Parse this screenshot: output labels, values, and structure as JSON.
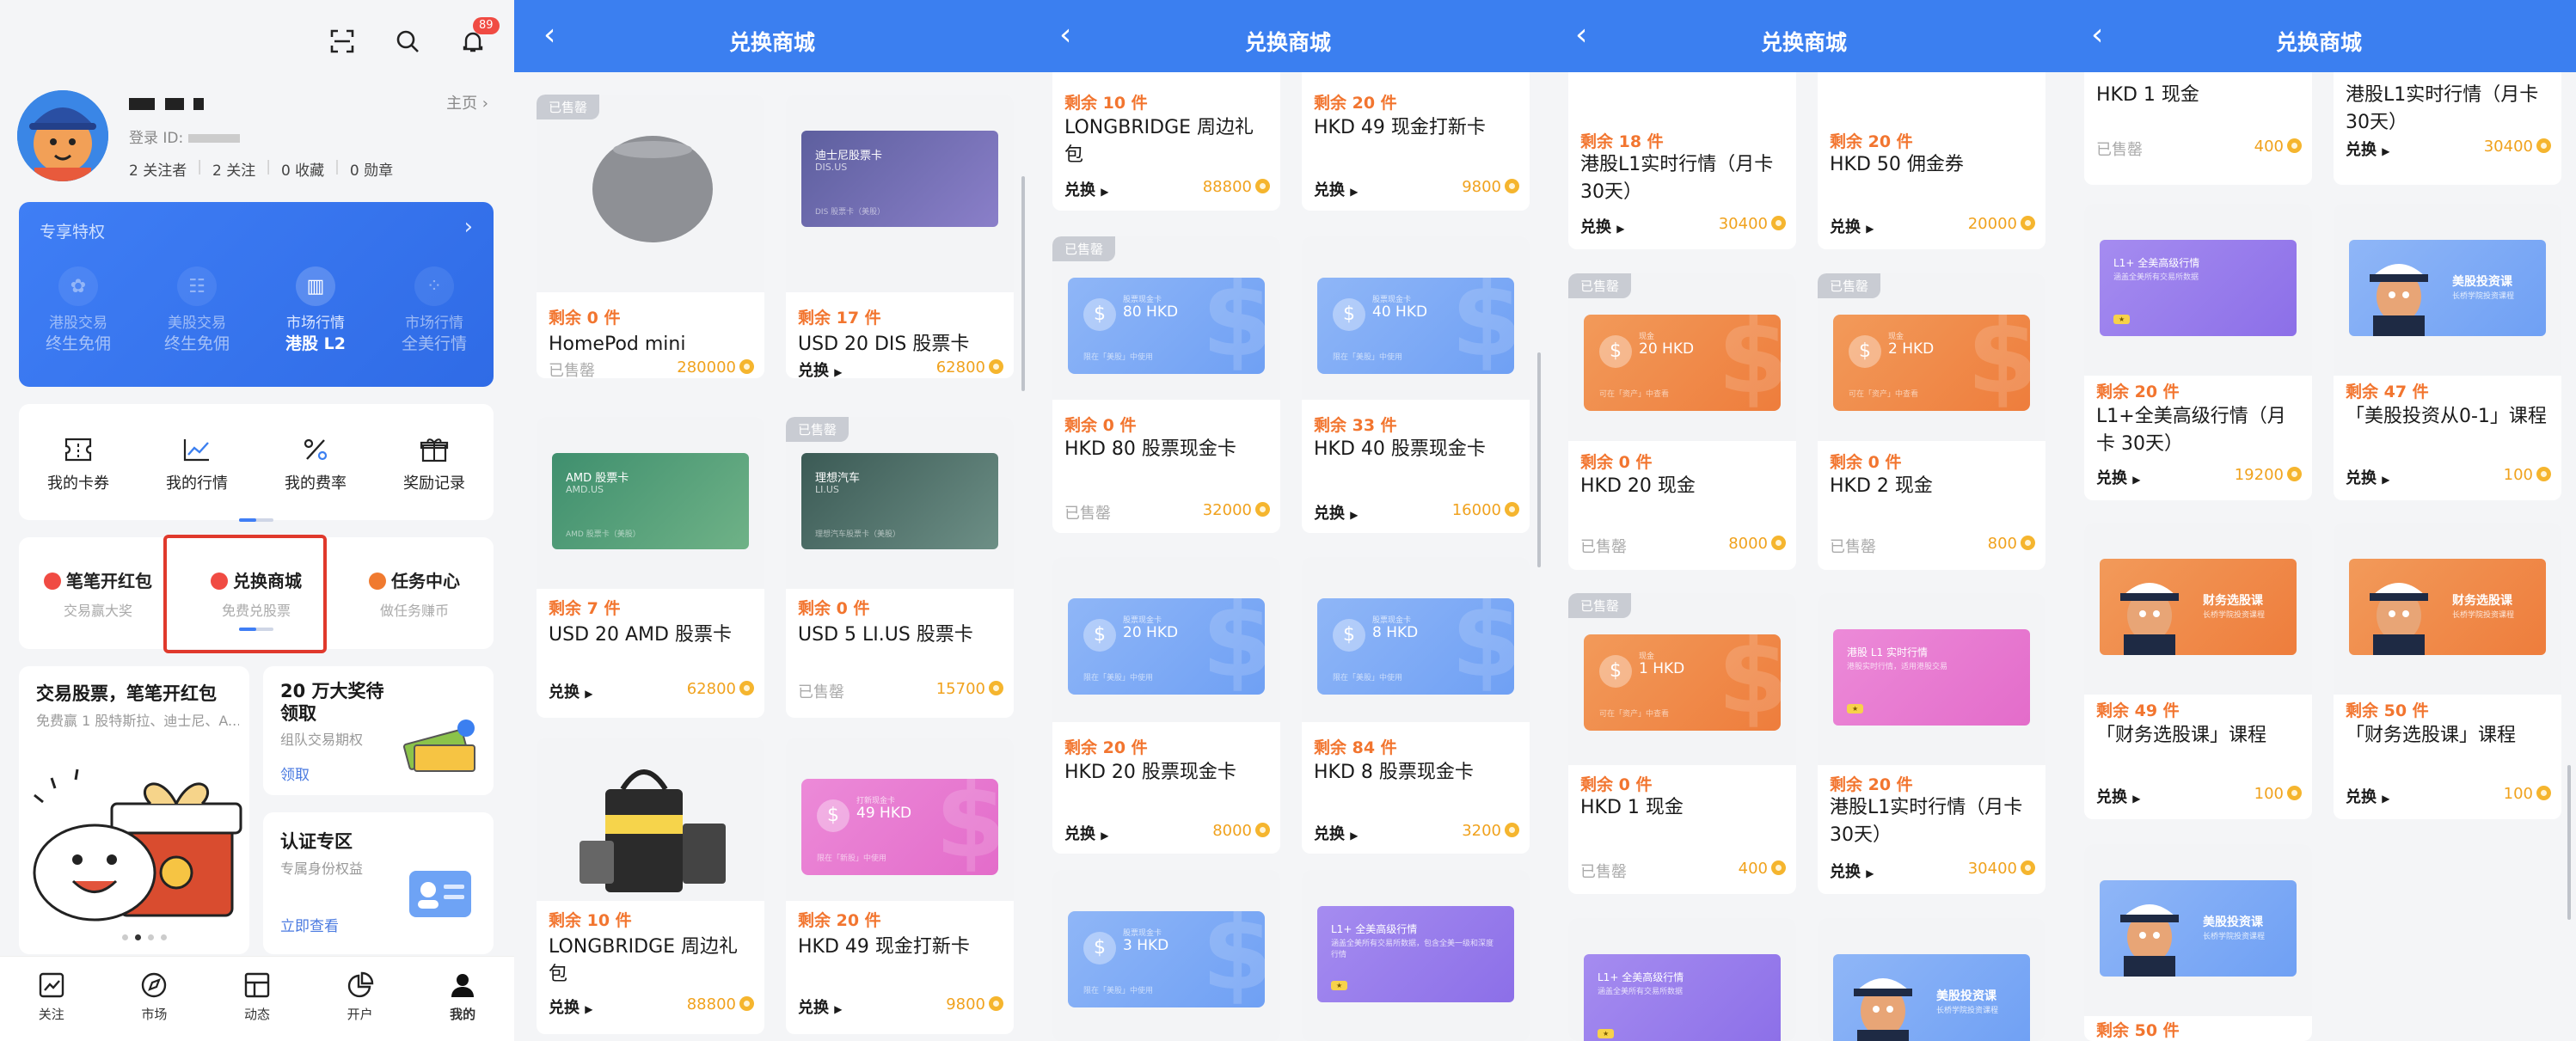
{
  "profile": {
    "badge_count": "89",
    "login_label": "登录 ID:",
    "home_link": "主页 ›",
    "stats": [
      "2 关注者",
      "2 关注",
      "0 收藏",
      "0 勋章"
    ],
    "vip": {
      "title": "专享特权",
      "items": [
        {
          "l1": "港股交易",
          "l2": "终生免佣",
          "on": false,
          "icon": "hongkong-flower-icon"
        },
        {
          "l1": "美股交易",
          "l2": "终生免佣",
          "on": false,
          "icon": "us-flag-icon"
        },
        {
          "l1": "市场行情",
          "l2": "港股 L2",
          "on": true,
          "icon": "bar-chart-icon"
        },
        {
          "l1": "市场行情",
          "l2": "全美行情",
          "on": false,
          "icon": "grid-icon"
        }
      ]
    },
    "quick": [
      "我的卡券",
      "我的行情",
      "我的费率",
      "奖励记录"
    ],
    "triple": [
      {
        "main": "笔笔开红包",
        "sub": "交易赢大奖",
        "color": "#f04b43"
      },
      {
        "main": "兑换商城",
        "sub": "免费兑股票",
        "color": "#f04b43"
      },
      {
        "main": "任务中心",
        "sub": "做任务赚币",
        "color": "#f07a2f"
      }
    ],
    "promo1": {
      "title": "交易股票，笔笔开红包",
      "sub": "免费赢 1 股特斯拉、迪士尼、A..."
    },
    "promo2": {
      "title": "20 万大奖待领取",
      "sub": "组队交易期权",
      "link": "领取"
    },
    "promo3": {
      "title": "认证专区",
      "sub": "专属身份权益",
      "link": "立即查看"
    },
    "tabs": [
      "关注",
      "市场",
      "动态",
      "开户",
      "我的"
    ]
  },
  "shop": {
    "title": "兑换商城",
    "sold_tag": "已售罄",
    "redeem": "兑换",
    "panels": [
      [
        {
          "rem": "剩余 0 件",
          "name": "HomePod mini",
          "act": "已售罄",
          "pts": "280000",
          "sold": true,
          "img": "homepod"
        },
        {
          "rem": "剩余 17 件",
          "name": "USD 20 DIS 股票卡",
          "act": "兑换",
          "pts": "62800",
          "sold": false,
          "img": "dis",
          "card_title": "迪士尼股票卡",
          "card_code": "DIS.US",
          "card_note": "DIS 股票卡（美股）"
        },
        {
          "rem": "剩余 7 件",
          "name": "USD 20 AMD 股票卡",
          "act": "兑换",
          "pts": "62800",
          "sold": false,
          "img": "amd",
          "card_title": "AMD 股票卡",
          "card_code": "AMD.US",
          "card_note": "AMD 股票卡（美股）"
        },
        {
          "rem": "剩余 0 件",
          "name": "USD 5 LI.US 股票卡",
          "act": "已售罄",
          "pts": "15700",
          "sold": true,
          "img": "li",
          "card_title": "理想汽车",
          "card_code": "LI.US",
          "card_note": "理想汽车股票卡（美股）"
        },
        {
          "rem": "剩余 10 件",
          "name": "LONGBRIDGE 周边礼包",
          "act": "兑换",
          "pts": "88800",
          "sold": false,
          "img": "bag"
        },
        {
          "rem": "剩余 20 件",
          "name": "HKD 49 现金打新卡",
          "act": "兑换",
          "pts": "9800",
          "sold": false,
          "img": "voucher",
          "color": "pink",
          "val": "49 HKD",
          "small": "打新现金卡",
          "bot": "限在「新股」中使用"
        }
      ],
      [
        {
          "rem": "剩余 10 件",
          "name": "LONGBRIDGE 周边礼包",
          "act": "兑换",
          "pts": "88800",
          "sold": false,
          "img": "top"
        },
        {
          "rem": "剩余 20 件",
          "name": "HKD 49 现金打新卡",
          "act": "兑换",
          "pts": "9800",
          "sold": false,
          "img": "top"
        },
        {
          "rem": "剩余 0 件",
          "name": "HKD 80 股票现金卡",
          "act": "已售罄",
          "pts": "32000",
          "sold": true,
          "img": "voucher",
          "color": "blue",
          "val": "80 HKD",
          "small": "股票现金卡",
          "bot": "限在「美股」中使用"
        },
        {
          "rem": "剩余 33 件",
          "name": "HKD 40 股票现金卡",
          "act": "兑换",
          "pts": "16000",
          "sold": false,
          "img": "voucher",
          "color": "blue",
          "val": "40 HKD",
          "small": "股票现金卡",
          "bot": "限在「美股」中使用"
        },
        {
          "rem": "剩余 20 件",
          "name": "HKD 20 股票现金卡",
          "act": "兑换",
          "pts": "8000",
          "sold": false,
          "img": "voucher",
          "color": "blue",
          "val": "20 HKD",
          "small": "股票现金卡",
          "bot": "限在「美股」中使用"
        },
        {
          "rem": "剩余 84 件",
          "name": "HKD 8 股票现金卡",
          "act": "兑换",
          "pts": "3200",
          "sold": false,
          "img": "voucher",
          "color": "blue",
          "val": "8 HKD",
          "small": "股票现金卡",
          "bot": "限在「美股」中使用"
        },
        {
          "rem": "",
          "name": "",
          "act": "",
          "pts": "",
          "sold": false,
          "img": "voucher",
          "color": "blue",
          "val": "3 HKD",
          "small": "股票现金卡",
          "bot": "限在「美股」中使用"
        },
        {
          "rem": "",
          "name": "",
          "act": "",
          "pts": "",
          "sold": false,
          "img": "l1",
          "color": "purple",
          "title": "L1+ 全美高级行情",
          "desc": "涵盖全美所有交易所数据，包含全美一级和深度行情"
        }
      ],
      [
        {
          "rem": "剩余 18 件",
          "name": "港股L1实时行情（月卡 30天）",
          "act": "兑换",
          "pts": "30400",
          "sold": false,
          "img": "top"
        },
        {
          "rem": "剩余 20 件",
          "name": "HKD 50 佣金券",
          "act": "兑换",
          "pts": "20000",
          "sold": false,
          "img": "top"
        },
        {
          "rem": "剩余 0 件",
          "name": "HKD 20 现金",
          "act": "已售罄",
          "pts": "8000",
          "sold": true,
          "img": "voucher",
          "color": "orange",
          "val": "20 HKD",
          "small": "现金",
          "bot": "可在「资产」中查看"
        },
        {
          "rem": "剩余 0 件",
          "name": "HKD 2 现金",
          "act": "已售罄",
          "pts": "800",
          "sold": true,
          "img": "voucher",
          "color": "orange",
          "val": "2 HKD",
          "small": "现金",
          "bot": "可在「资产」中查看"
        },
        {
          "rem": "剩余 0 件",
          "name": "HKD 1 现金",
          "act": "已售罄",
          "pts": "400",
          "sold": true,
          "img": "voucher",
          "color": "orange",
          "val": "1 HKD",
          "small": "现金",
          "bot": "可在「资产」中查看"
        },
        {
          "rem": "剩余 20 件",
          "name": "港股L1实时行情（月卡 30天）",
          "act": "兑换",
          "pts": "30400",
          "sold": false,
          "img": "l1",
          "color": "pink",
          "title": "港股 L1 实时行情",
          "desc": "港股实时行情，适用港股交易"
        },
        {
          "rem": "",
          "name": "",
          "act": "",
          "pts": "",
          "sold": false,
          "img": "l1",
          "color": "purple",
          "title": "L1+ 全美高级行情",
          "desc": "涵盖全美所有交易所数据"
        },
        {
          "rem": "",
          "name": "",
          "act": "",
          "pts": "",
          "sold": false,
          "img": "captain",
          "color": "blue",
          "title": "美股投资课",
          "desc": "长桥学院投资课程"
        }
      ],
      [
        {
          "rem": "",
          "name": "HKD 1 现金",
          "act": "已售罄",
          "pts": "400",
          "sold": false,
          "img": "none"
        },
        {
          "rem": "",
          "name": "港股L1实时行情（月卡 30天）",
          "act": "兑换",
          "pts": "30400",
          "sold": false,
          "img": "none"
        },
        {
          "rem": "剩余 20 件",
          "name": "L1+全美高级行情（月卡 30天）",
          "act": "兑换",
          "pts": "19200",
          "sold": false,
          "img": "l1",
          "color": "purple",
          "title": "L1+ 全美高级行情",
          "desc": "涵盖全美所有交易所数据"
        },
        {
          "rem": "剩余 47 件",
          "name": "「美股投资从0-1」课程",
          "act": "兑换",
          "pts": "100",
          "sold": false,
          "img": "captain",
          "color": "blue",
          "title": "美股投资课",
          "desc": "长桥学院投资课程"
        },
        {
          "rem": "剩余 49 件",
          "name": "「财务选股课」课程",
          "act": "兑换",
          "pts": "100",
          "sold": false,
          "img": "captain",
          "color": "orange",
          "title": "财务选股课",
          "desc": "长桥学院投资课程"
        },
        {
          "rem": "剩余 50 件",
          "name": "「财务选股课」课程",
          "act": "兑换",
          "pts": "100",
          "sold": false,
          "img": "captain",
          "color": "orange",
          "title": "财务选股课",
          "desc": "长桥学院投资课程"
        },
        {
          "rem": "剩余 50 件",
          "name": "",
          "act": "",
          "pts": "",
          "sold": false,
          "img": "captain",
          "color": "blue",
          "title": "美股投资课",
          "desc": "长桥学院投资课程"
        }
      ]
    ]
  },
  "colors": {
    "brand_blue": "#3b7ff0",
    "orange": "#f2752f",
    "highlight": "#e0392c",
    "coin": "#f5b52e"
  }
}
